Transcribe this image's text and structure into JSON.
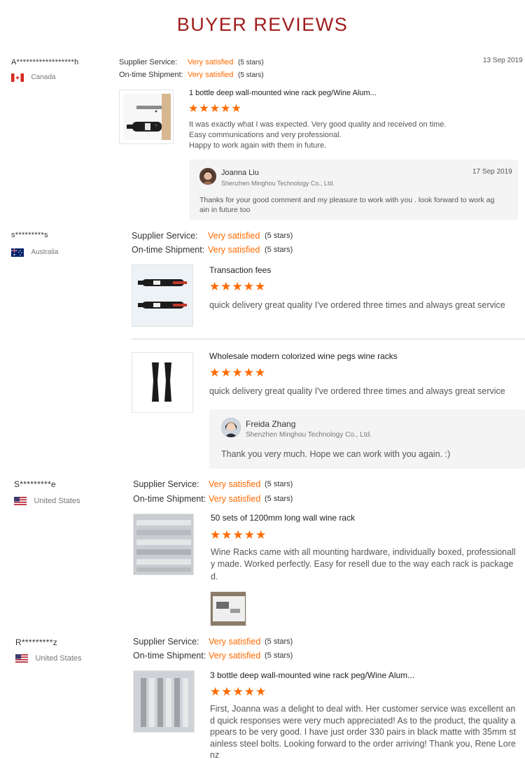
{
  "heading": "BUYER REVIEWS",
  "labels": {
    "supplier_service": "Supplier Service:",
    "on_time_shipment": "On-time Shipment:",
    "very_satisfied": "Very satisfied",
    "five_stars": "(5 stars)",
    "star_glyphs": "★★★★★"
  },
  "rating_stars": 5,
  "colors": {
    "heading": "#a01c1c",
    "accent": "#ff6a00"
  },
  "reviews": [
    {
      "buyer": "A******************h",
      "country": "Canada",
      "flag": "canada-flag",
      "date": "13 Sep 2019",
      "items": [
        {
          "product": "1 bottle deep wall-mounted wine rack peg/Wine Alum...",
          "lines": [
            "It was exactly what I was expected. Very good quality and received on time.",
            "Easy communications and very professional.",
            "Happy to work again with them in future."
          ],
          "reply": {
            "name": "Joanna Liu",
            "company": "Shenzhen Minghou Technology Co., Ltd.",
            "date": "17 Sep 2019",
            "lines": [
              "Thanks for your good comment and my pleasure to work with you . look forward to work ag",
              "ain in future too"
            ]
          }
        }
      ]
    },
    {
      "buyer": "s*********s",
      "country": "Australia",
      "flag": "australia-flag",
      "items": [
        {
          "product": "Transaction fees",
          "lines": [
            "quick delivery great quality I've ordered three times and always great service"
          ]
        },
        {
          "product": "Wholesale modern colorized wine pegs wine racks",
          "lines": [
            "quick delivery great quality I've ordered three times and always great service"
          ],
          "reply": {
            "name": "Freida Zhang",
            "company": "Shenzhen Minghou Technology Co., Ltd.",
            "lines": [
              "Thank you very much. Hope we can work with you again. :)"
            ]
          }
        }
      ]
    },
    {
      "buyer": "S*********e",
      "country": "United States",
      "flag": "united-states-flag",
      "items": [
        {
          "product": "50 sets of 1200mm long wall wine rack",
          "lines": [
            "Wine Racks came with all mounting hardware, individually boxed, professionall",
            "y made. Worked perfectly.  Easy for resell due to the way each rack is package",
            "d."
          ]
        }
      ]
    },
    {
      "buyer": "R*********z",
      "country": "United States",
      "flag": "united-states-flag",
      "items": [
        {
          "product": "3 bottle deep wall-mounted wine rack peg/Wine Alum...",
          "lines": [
            "First, Joanna was a delight to deal with. Her customer service was excellent an",
            "d quick responses were very much appreciated! As to the product, the quality a",
            "ppears to be very good. I have just order 330 pairs in black matte with 35mm st",
            "ainless steel bolts. Looking forward to the order arriving! Thank you, Rene Lore",
            "nz"
          ]
        }
      ]
    }
  ]
}
